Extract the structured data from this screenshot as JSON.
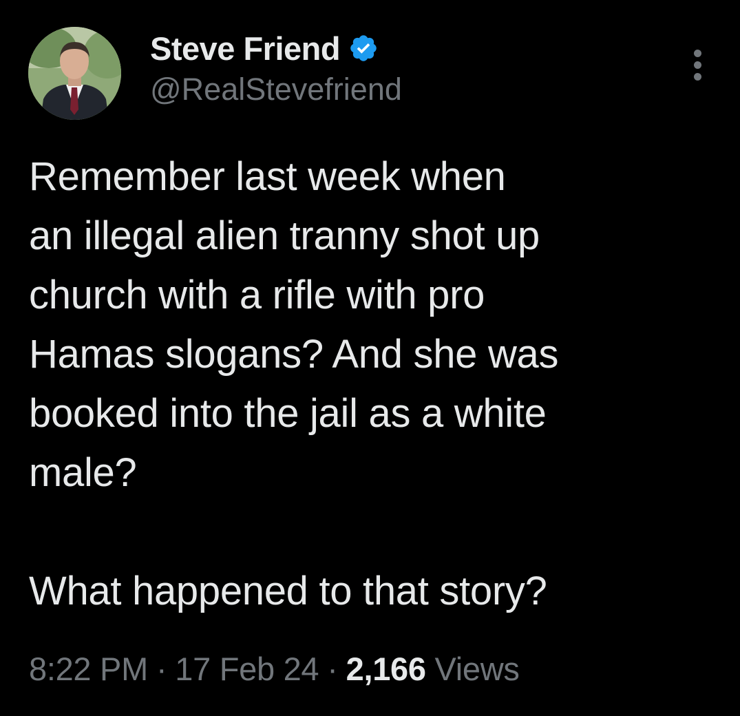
{
  "author": {
    "display_name": "Steve Friend",
    "handle": "@RealStevefriend",
    "verified": true,
    "verified_color": "#1d9bf0"
  },
  "icons": {
    "avatar": "profile-photo",
    "verified": "verified-badge-icon",
    "more": "more-options-icon"
  },
  "tweet": {
    "lines": [
      "Remember last week when",
      "an illegal alien tranny shot up",
      "church with a rifle with pro",
      "Hamas slogans? And she was",
      "booked into the jail as a white",
      "male?"
    ],
    "closing_line": "What happened to that story?"
  },
  "meta": {
    "time": "8:22 PM",
    "separator": "·",
    "date": "17 Feb 24",
    "views_count": "2,166",
    "views_label": "Views"
  },
  "colors": {
    "background": "#000000",
    "primary_text": "#e7e9ea",
    "secondary_text": "#71767b"
  }
}
